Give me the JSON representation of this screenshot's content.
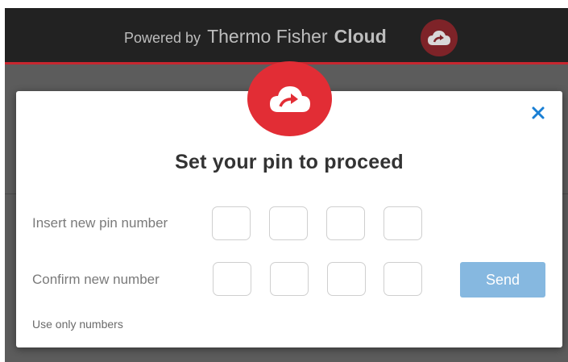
{
  "header": {
    "powered_by": "Powered by",
    "brand": "Thermo Fisher",
    "product": "Cloud"
  },
  "modal": {
    "title": "Set your pin to proceed",
    "close_icon": "close-icon",
    "logo_icon": "cloud-upload-icon",
    "new_pin": {
      "label": "Insert new pin number",
      "digits": [
        "",
        "",
        "",
        ""
      ]
    },
    "confirm_pin": {
      "label": "Confirm new number",
      "digits": [
        "",
        "",
        "",
        ""
      ]
    },
    "send_label": "Send",
    "hint": "Use only numbers"
  },
  "colors": {
    "accent_red": "#e22d35",
    "dark_red": "#7e2328",
    "header_bg": "#222222",
    "close_blue": "#1a7fd4",
    "send_bg": "#86b8e0"
  }
}
